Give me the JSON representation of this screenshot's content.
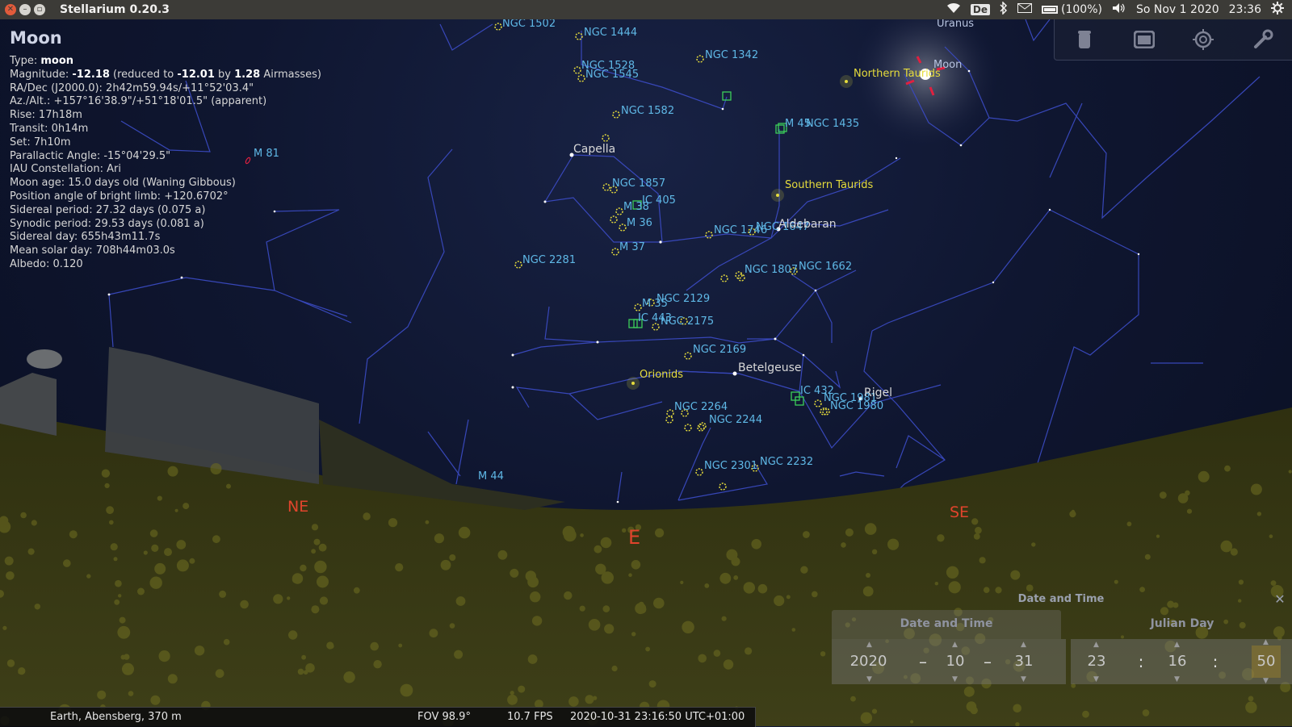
{
  "window": {
    "app_title": "Stellarium 0.20.3",
    "tray": {
      "keyboard": "De",
      "battery": "(100%)",
      "date": "So Nov 1 2020",
      "time": "23:36"
    }
  },
  "info_panel": {
    "object_name": "Moon",
    "type_label": "Type: ",
    "type_value": "moon",
    "magnitude_label": "Magnitude: ",
    "magnitude_value": "-12.18",
    "magnitude_reduced_text": " (reduced to ",
    "magnitude_reduced_value": "-12.01",
    "magnitude_by_text": " by ",
    "magnitude_airmass_value": "1.28",
    "magnitude_airmass_text": " Airmasses)",
    "lines": [
      "RA/Dec (J2000.0): 2h42m59.94s/+11°52'03.4\"",
      "Az./Alt.: +157°16'38.9\"/+51°18'01.5\" (apparent)",
      "Rise: 17h18m",
      "Transit: 0h14m",
      "Set: 7h10m",
      "Parallactic Angle: -15°04'29.5\"",
      "IAU Constellation: Ari",
      "Moon age: 15.0 days old (Waning Gibbous)",
      "Position angle of bright limb: +120.6702°",
      "Sidereal period: 27.32 days (0.075 a)",
      "Synodic period: 29.53 days (0.081 a)",
      "Sidereal day: 655h43m11.7s",
      "Mean solar day: 708h44m03.0s",
      "Albedo: 0.120"
    ]
  },
  "sky": {
    "colors": {
      "dso_label": "#5fb8e6",
      "dso_marker": "#e6dc3c",
      "nebula_marker": "#3ccf5a",
      "star_label": "#d8d8d8",
      "meteor_label": "#e6dc3c",
      "cardinal": "#e0442c",
      "constellation_line": "#3a4ac0",
      "moon_marker": "#e02040"
    },
    "dso_labels": [
      "NGC 1502",
      "NGC 1444",
      "NGC 1342",
      "NGC 1528",
      "NGC 1545",
      "NGC 1582",
      "M 45",
      "NGC 1435",
      "NGC 1857",
      "IC 405",
      "M 38",
      "M 36",
      "M 37",
      "NGC 2281",
      "NGC 1746",
      "NGC 1647",
      "NGC 1807",
      "NGC 1662",
      "M 35",
      "NGC 2129",
      "IC 443",
      "NGC 2175",
      "NGC 2169",
      "IC 432",
      "NGC 1981",
      "NGC 1980",
      "NGC 2264",
      "NGC 2244",
      "NGC 2301",
      "NGC 2232",
      "M 44",
      "M 81"
    ],
    "star_labels": [
      "Capella",
      "Aldebaran",
      "Betelgeuse",
      "Rigel"
    ],
    "planet_labels": [
      "Uranus",
      "Moon"
    ],
    "meteor_labels": [
      "Northern Taurids",
      "Southern Taurids",
      "Orionids"
    ],
    "cardinals": [
      "NE",
      "E",
      "SE"
    ]
  },
  "toolbar": {
    "icons": [
      "trash-icon",
      "window-icon",
      "target-icon",
      "wrench-icon"
    ]
  },
  "date_time_dialog": {
    "title": "Date and Time",
    "close": "✕",
    "tab_date_time": "Date and Time",
    "tab_julian_day": "Julian Day",
    "year": "2020",
    "month": "10",
    "day": "31",
    "hour": "23",
    "minute": "16",
    "second": "50",
    "date_sep": "–",
    "time_sep": ":"
  },
  "status_bar": {
    "location": "Earth, Abensberg, 370 m",
    "fov": "FOV 98.9°",
    "fps": "10.7 FPS",
    "datetime": "2020-10-31 23:16:50 UTC+01:00"
  }
}
